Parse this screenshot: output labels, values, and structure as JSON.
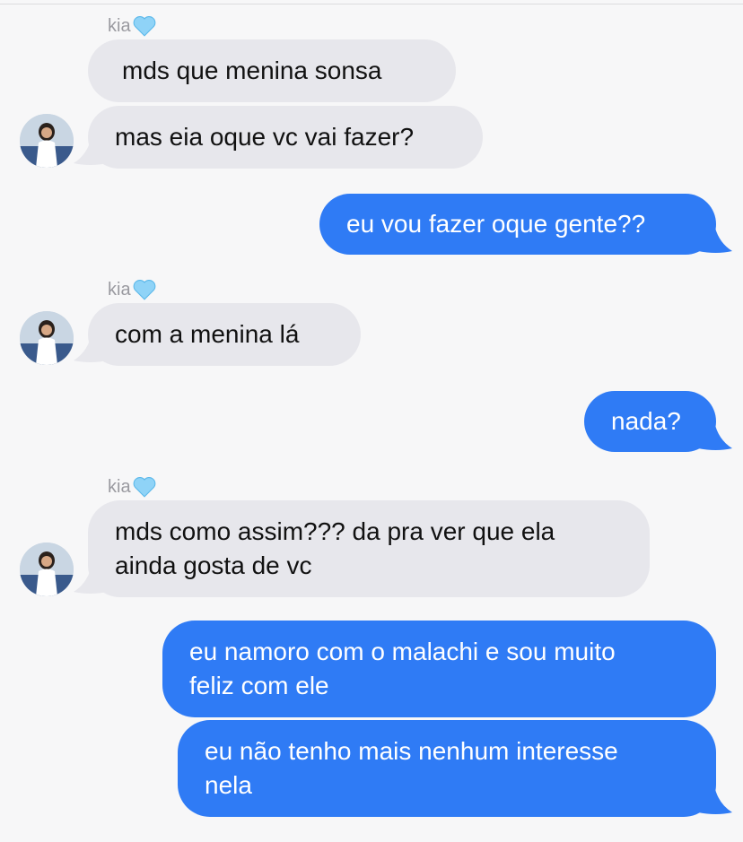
{
  "chat": {
    "sender_name": "kia",
    "messages": [
      {
        "from": "kia",
        "text": "mds que menina sonsa"
      },
      {
        "from": "kia",
        "text": "mas eia oque vc vai fazer?"
      },
      {
        "from": "me",
        "text": "eu vou fazer oque gente??"
      },
      {
        "from": "kia",
        "text": "com a menina lá"
      },
      {
        "from": "me",
        "text": "nada?"
      },
      {
        "from": "kia",
        "line1": "mds como assim??? da pra ver que ela",
        "line2": "ainda gosta de vc"
      },
      {
        "from": "me",
        "line1": "eu namoro com o malachi e sou muito",
        "line2": "feliz com ele"
      },
      {
        "from": "me",
        "line1": "eu não tenho mais nenhum interesse",
        "line2": "nela"
      }
    ]
  },
  "colors": {
    "incoming_bubble": "#e7e7ec",
    "outgoing_bubble": "#2f7bf5",
    "sender_name": "#9a9aa0",
    "background": "#f7f7f8"
  },
  "icons": {
    "heart": "light-blue-heart-emoji",
    "avatar": "contact-photo"
  }
}
